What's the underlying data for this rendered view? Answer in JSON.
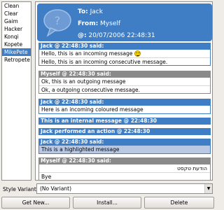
{
  "styles": {
    "items": [
      "Clean",
      "Clear",
      "Gaim",
      "Hacker",
      "Konqi",
      "Kopete",
      "MikePete",
      "Retropete"
    ],
    "selected": "MikePete"
  },
  "header": {
    "to_label": "To:",
    "to_value": "Jack",
    "from_label": "From:",
    "from_value": "Myself",
    "at_label": "@:",
    "at_value": "20/07/2006 22:48:31"
  },
  "messages": {
    "m1": {
      "head": "Jack @ 22:48:30 said:",
      "line1": "Hello, this is an incoming message",
      "line2": "Hello, this is an incoming consecutive message."
    },
    "m2": {
      "head": "Myself @ 22:48:30 said:",
      "line1": "Ok, this is an outgoing message",
      "line2": "Ok, a outgoing consecutive message."
    },
    "m3": {
      "head": "Jack @ 22:48:30 said:",
      "line1": "Here is an incoming coloured message"
    },
    "m4": {
      "head": "This is an internal message @ 22:48:30"
    },
    "m5": {
      "head": "Jack performed an action @ 22:48:30"
    },
    "m6": {
      "head": "Jack @ 22:48:30 said:",
      "line1": "This is a highlighted message"
    },
    "m7": {
      "head": "Myself @ 22:48:30 said:",
      "line1": "הודעת טקסט",
      "line2": "Bye"
    }
  },
  "variant": {
    "label": "Style Variant:",
    "value": "(No Variant)"
  },
  "buttons": {
    "get_new": "Get New...",
    "install": "Install...",
    "delete": "Delete"
  },
  "colors": {
    "accent": "#3f7dc4",
    "outgoing": "#8a8a8a",
    "highlight": "#b9c8e3"
  }
}
